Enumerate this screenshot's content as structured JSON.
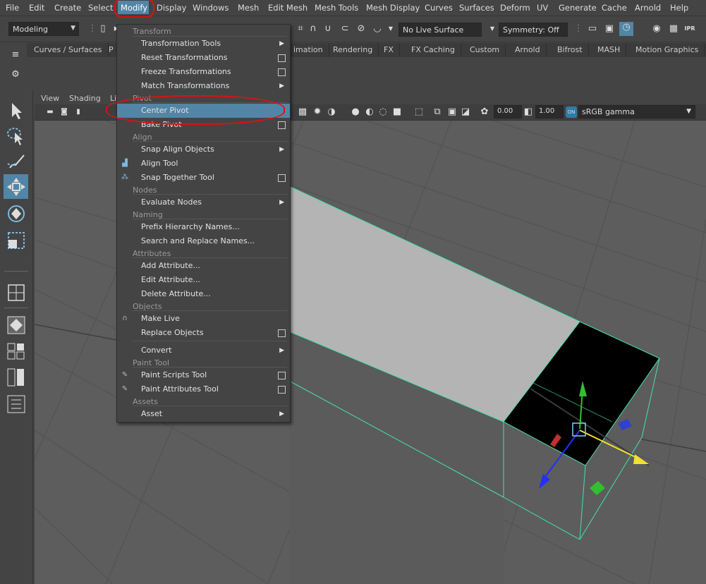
{
  "menubar": {
    "items": [
      "File",
      "Edit",
      "Create",
      "Select",
      "Modify",
      "Display",
      "Windows",
      "Mesh",
      "Edit Mesh",
      "Mesh Tools",
      "Mesh Display",
      "Curves",
      "Surfaces",
      "Deform",
      "UV",
      "Generate",
      "Cache",
      "Arnold",
      "Help"
    ]
  },
  "statusline": {
    "menuset": "Modeling",
    "live_surface": "No Live Surface",
    "symmetry": "Symmetry: Off"
  },
  "shelf": {
    "tabs": [
      "Curves / Surfaces",
      "P",
      "imation",
      "Rendering",
      "FX",
      "FX Caching",
      "Custom",
      "Arnold",
      "Bifrost",
      "MASH",
      "Motion Graphics"
    ]
  },
  "viewport": {
    "menu": [
      "View",
      "Shading",
      "Li"
    ],
    "exposure": "0.00",
    "gamma": "1.00",
    "color_space": "sRGB gamma"
  },
  "dropdown": {
    "sections": {
      "transform": "Transform",
      "pivot": "Pivot",
      "align": "Align",
      "nodes": "Nodes",
      "naming": "Naming",
      "attributes": "Attributes",
      "objects": "Objects",
      "paint_tool": "Paint Tool",
      "assets": "Assets"
    },
    "items": {
      "transformation_tools": "Transformation Tools",
      "reset_transformations": "Reset Transformations",
      "freeze_transformations": "Freeze Transformations",
      "match_transformations": "Match Transformations",
      "center_pivot": "Center Pivot",
      "bake_pivot": "Bake Pivot",
      "snap_align_objects": "Snap Align Objects",
      "align_tool": "Align Tool",
      "snap_together_tool": "Snap Together Tool",
      "evaluate_nodes": "Evaluate Nodes",
      "prefix_hierarchy_names": "Prefix Hierarchy Names...",
      "search_replace_names": "Search and Replace Names...",
      "add_attribute": "Add Attribute...",
      "edit_attribute": "Edit Attribute...",
      "delete_attribute": "Delete Attribute...",
      "make_live": "Make Live",
      "replace_objects": "Replace Objects",
      "convert": "Convert",
      "paint_scripts_tool": "Paint Scripts Tool",
      "paint_attributes_tool": "Paint Attributes Tool",
      "asset": "Asset"
    }
  },
  "colors": {
    "highlight": "#5285a6",
    "annotation": "#e01010",
    "wireframe": "#44e0b0"
  }
}
